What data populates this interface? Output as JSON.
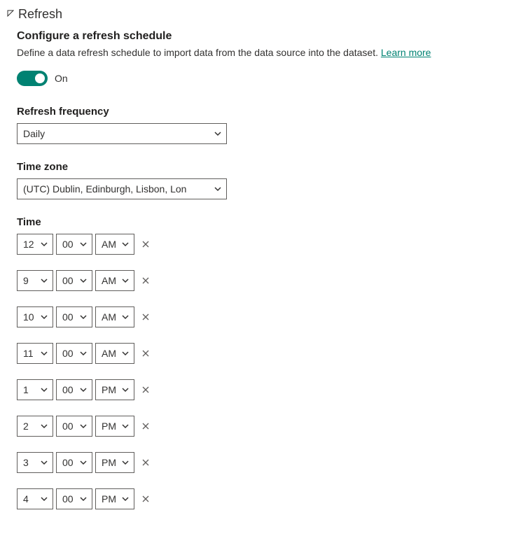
{
  "section": {
    "title": "Refresh",
    "subtitle": "Configure a refresh schedule",
    "description": "Define a data refresh schedule to import data from the data source into the dataset.",
    "learn_more": "Learn more"
  },
  "toggle": {
    "state": "on",
    "label": "On"
  },
  "frequency": {
    "label": "Refresh frequency",
    "value": "Daily"
  },
  "timezone": {
    "label": "Time zone",
    "value": "(UTC) Dublin, Edinburgh, Lisbon, Lon"
  },
  "time": {
    "label": "Time",
    "rows": [
      {
        "hour": "12",
        "minute": "00",
        "ampm": "AM"
      },
      {
        "hour": "9",
        "minute": "00",
        "ampm": "AM"
      },
      {
        "hour": "10",
        "minute": "00",
        "ampm": "AM"
      },
      {
        "hour": "11",
        "minute": "00",
        "ampm": "AM"
      },
      {
        "hour": "1",
        "minute": "00",
        "ampm": "PM"
      },
      {
        "hour": "2",
        "minute": "00",
        "ampm": "PM"
      },
      {
        "hour": "3",
        "minute": "00",
        "ampm": "PM"
      },
      {
        "hour": "4",
        "minute": "00",
        "ampm": "PM"
      }
    ]
  }
}
